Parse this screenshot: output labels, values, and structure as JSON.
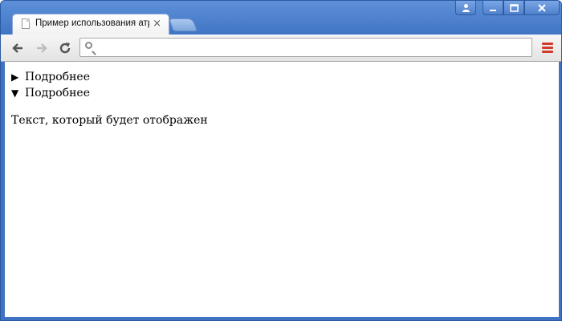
{
  "tab": {
    "title": "Пример использования атр",
    "close": "×"
  },
  "window_controls": {
    "user": "👤",
    "minimize": "_",
    "maximize": "□",
    "close": "✕"
  },
  "toolbar": {
    "back": "←",
    "forward": "→",
    "reload": "C",
    "omnibox_value": "",
    "omnibox_placeholder": ""
  },
  "content": {
    "details": [
      {
        "summary": "Подробнее",
        "open": false,
        "marker": "▶"
      },
      {
        "summary": "Подробнее",
        "open": true,
        "marker": "▼",
        "text": "Текст, который будет отображен"
      }
    ]
  },
  "colors": {
    "frame": "#3f72c2",
    "menu": "#d23a2c"
  }
}
